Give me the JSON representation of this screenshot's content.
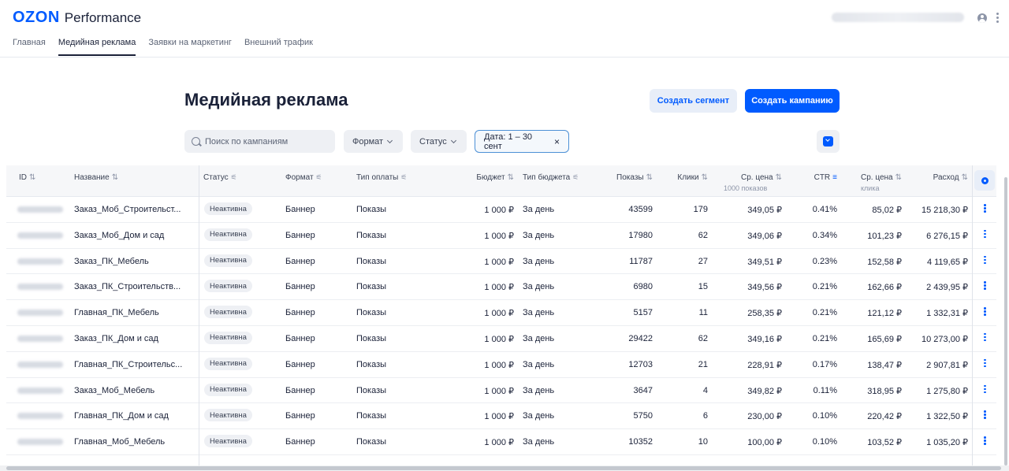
{
  "brand": {
    "logo_main": "OZON",
    "logo_sub": "Performance"
  },
  "nav": {
    "tabs": [
      {
        "label": "Главная"
      },
      {
        "label": "Медийная реклама"
      },
      {
        "label": "Заявки на маркетинг"
      },
      {
        "label": "Внешний трафик"
      }
    ],
    "active_index": 1
  },
  "page": {
    "title": "Медийная реклама"
  },
  "actions": {
    "create_segment": "Создать сегмент",
    "create_campaign": "Создать кампанию"
  },
  "filters": {
    "search_placeholder": "Поиск по кампаниям",
    "format_label": "Формат",
    "status_label": "Статус",
    "date_label": "Дата: 1 – 30 сент",
    "date_clear": "×"
  },
  "table": {
    "headers": {
      "id": "ID",
      "name": "Название",
      "status": "Статус",
      "format": "Формат",
      "payment": "Тип оплаты",
      "budget": "Бюджет",
      "budget_type": "Тип бюджета",
      "impressions": "Показы",
      "clicks": "Клики",
      "avg_price": "Ср. цена",
      "avg_price_sub": "1000 показов",
      "ctr": "CTR",
      "avg_click": "Ср. цена",
      "avg_click_sub": "клика",
      "spend": "Расход"
    },
    "rows": [
      {
        "name": "Заказ_Моб_Строительст...",
        "status": "Неактивна",
        "format": "Баннер",
        "payment": "Показы",
        "budget": "1 000 ₽",
        "budget_type": "За день",
        "impressions": "43599",
        "clicks": "179",
        "avg_price": "349,05 ₽",
        "ctr": "0.41%",
        "avg_click": "85,02 ₽",
        "spend": "15 218,30 ₽"
      },
      {
        "name": "Заказ_Моб_Дом и сад",
        "status": "Неактивна",
        "format": "Баннер",
        "payment": "Показы",
        "budget": "1 000 ₽",
        "budget_type": "За день",
        "impressions": "17980",
        "clicks": "62",
        "avg_price": "349,06 ₽",
        "ctr": "0.34%",
        "avg_click": "101,23 ₽",
        "spend": "6 276,15 ₽"
      },
      {
        "name": "Заказ_ПК_Мебель",
        "status": "Неактивна",
        "format": "Баннер",
        "payment": "Показы",
        "budget": "1 000 ₽",
        "budget_type": "За день",
        "impressions": "11787",
        "clicks": "27",
        "avg_price": "349,51 ₽",
        "ctr": "0.23%",
        "avg_click": "152,58 ₽",
        "spend": "4 119,65 ₽"
      },
      {
        "name": "Заказ_ПК_Строительств...",
        "status": "Неактивна",
        "format": "Баннер",
        "payment": "Показы",
        "budget": "1 000 ₽",
        "budget_type": "За день",
        "impressions": "6980",
        "clicks": "15",
        "avg_price": "349,56 ₽",
        "ctr": "0.21%",
        "avg_click": "162,66 ₽",
        "spend": "2 439,95 ₽"
      },
      {
        "name": "Главная_ПК_Мебель",
        "status": "Неактивна",
        "format": "Баннер",
        "payment": "Показы",
        "budget": "1 000 ₽",
        "budget_type": "За день",
        "impressions": "5157",
        "clicks": "11",
        "avg_price": "258,35 ₽",
        "ctr": "0.21%",
        "avg_click": "121,12 ₽",
        "spend": "1 332,31 ₽"
      },
      {
        "name": "Заказ_ПК_Дом и сад",
        "status": "Неактивна",
        "format": "Баннер",
        "payment": "Показы",
        "budget": "1 000 ₽",
        "budget_type": "За день",
        "impressions": "29422",
        "clicks": "62",
        "avg_price": "349,16 ₽",
        "ctr": "0.21%",
        "avg_click": "165,69 ₽",
        "spend": "10 273,00 ₽"
      },
      {
        "name": "Главная_ПК_Строительс...",
        "status": "Неактивна",
        "format": "Баннер",
        "payment": "Показы",
        "budget": "1 000 ₽",
        "budget_type": "За день",
        "impressions": "12703",
        "clicks": "21",
        "avg_price": "228,91 ₽",
        "ctr": "0.17%",
        "avg_click": "138,47 ₽",
        "spend": "2 907,81 ₽"
      },
      {
        "name": "Заказ_Моб_Мебель",
        "status": "Неактивна",
        "format": "Баннер",
        "payment": "Показы",
        "budget": "1 000 ₽",
        "budget_type": "За день",
        "impressions": "3647",
        "clicks": "4",
        "avg_price": "349,82 ₽",
        "ctr": "0.11%",
        "avg_click": "318,95 ₽",
        "spend": "1 275,80 ₽"
      },
      {
        "name": "Главная_ПК_Дом и сад",
        "status": "Неактивна",
        "format": "Баннер",
        "payment": "Показы",
        "budget": "1 000 ₽",
        "budget_type": "За день",
        "impressions": "5750",
        "clicks": "6",
        "avg_price": "230,00 ₽",
        "ctr": "0.10%",
        "avg_click": "220,42 ₽",
        "spend": "1 322,50 ₽"
      },
      {
        "name": "Главная_Моб_Мебель",
        "status": "Неактивна",
        "format": "Баннер",
        "payment": "Показы",
        "budget": "1 000 ₽",
        "budget_type": "За день",
        "impressions": "10352",
        "clicks": "10",
        "avg_price": "100,00 ₽",
        "ctr": "0.10%",
        "avg_click": "103,52 ₽",
        "spend": "1 035,20 ₽"
      }
    ]
  },
  "colors": {
    "brand": "#005bff",
    "text": "#1a2138",
    "muted": "#5c6476"
  }
}
